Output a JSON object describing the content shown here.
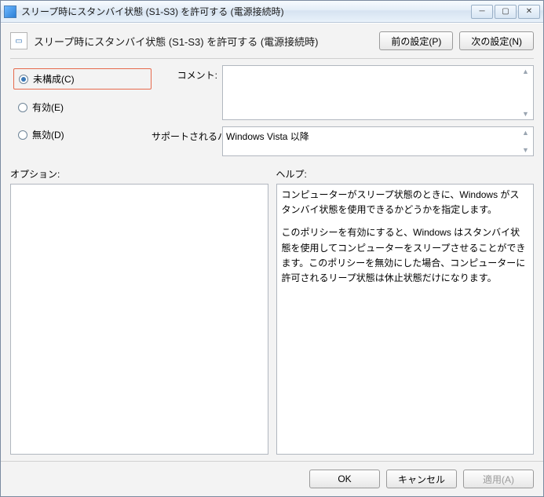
{
  "window": {
    "title": "スリープ時にスタンバイ状態 (S1-S3) を許可する (電源接続時)"
  },
  "header": {
    "policy_title": "スリープ時にスタンバイ状態 (S1-S3) を許可する (電源接続時)",
    "prev_btn": "前の設定(P)",
    "next_btn": "次の設定(N)"
  },
  "radios": {
    "not_configured": "未構成(C)",
    "enabled": "有効(E)",
    "disabled": "無効(D)"
  },
  "labels": {
    "comment": "コメント:",
    "supported": "サポートされるバージョン:",
    "options": "オプション:",
    "help": "ヘルプ:"
  },
  "fields": {
    "comment_value": "",
    "supported_value": "Windows Vista 以降"
  },
  "help": {
    "p1": "コンピューターがスリープ状態のときに、Windows がスタンバイ状態を使用できるかどうかを指定します。",
    "p2": "このポリシーを有効にすると、Windows はスタンバイ状態を使用してコンピューターをスリープさせることができます。このポリシーを無効にした場合、コンピューターに許可されるリープ状態は休止状態だけになります。"
  },
  "footer": {
    "ok": "OK",
    "cancel": "キャンセル",
    "apply": "適用(A)"
  }
}
